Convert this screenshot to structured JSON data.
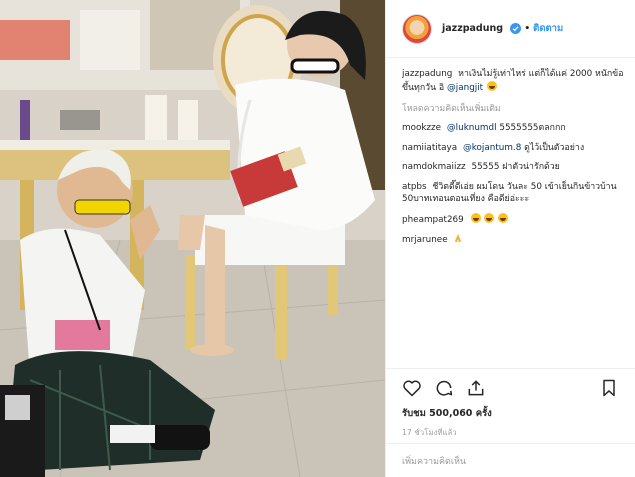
{
  "photo": {
    "alt_subject": "post-photo"
  },
  "header": {
    "username": "jazzpadung",
    "separator": "•",
    "follow_label": "ติดตาม"
  },
  "caption": {
    "username": "jazzpadung",
    "text": "หาเงินไม่รู้เท่าไหร่ แต่ก็ได้แค่ 2000 หนักข้อขึ้นทุกวัน อิ",
    "mention": "@jangjit"
  },
  "load_more": "โหลดความคิดเห็นเพิ่มเติม",
  "comments": [
    {
      "user": "mookzze",
      "mention": "@luknumdl",
      "text": "5555555ตลกกก"
    },
    {
      "user": "namiiatitaya",
      "mention": "@kojantum.8",
      "text": "ดูไว้เป็นตัวอย่าง"
    },
    {
      "user": "namdokmaiizz",
      "mention": "",
      "text": "55555 ฝาตัวน่ารักด้วย"
    },
    {
      "user": "atpbs",
      "mention": "",
      "text": "ชีวิตดี๊ดีเอ่ย ผมโดน วันละ 50 เข้าเย็นกินข้าวบ้าน 50บาทเทอนตอนเที่ยง คือดีย่อ่ะะะ"
    },
    {
      "user": "pheampat269",
      "mention": "",
      "text": ""
    },
    {
      "user": "mrjarunee",
      "mention": "",
      "text": ""
    }
  ],
  "stats": {
    "views": "รับชม 500,060 ครั้ง",
    "time": "17 ชั่วโมงที่แล้ว"
  },
  "add_comment_placeholder": "เพิ่มความคิดเห็น",
  "colors": {
    "link": "#3897f0",
    "mention": "#003569",
    "muted": "#999999"
  }
}
